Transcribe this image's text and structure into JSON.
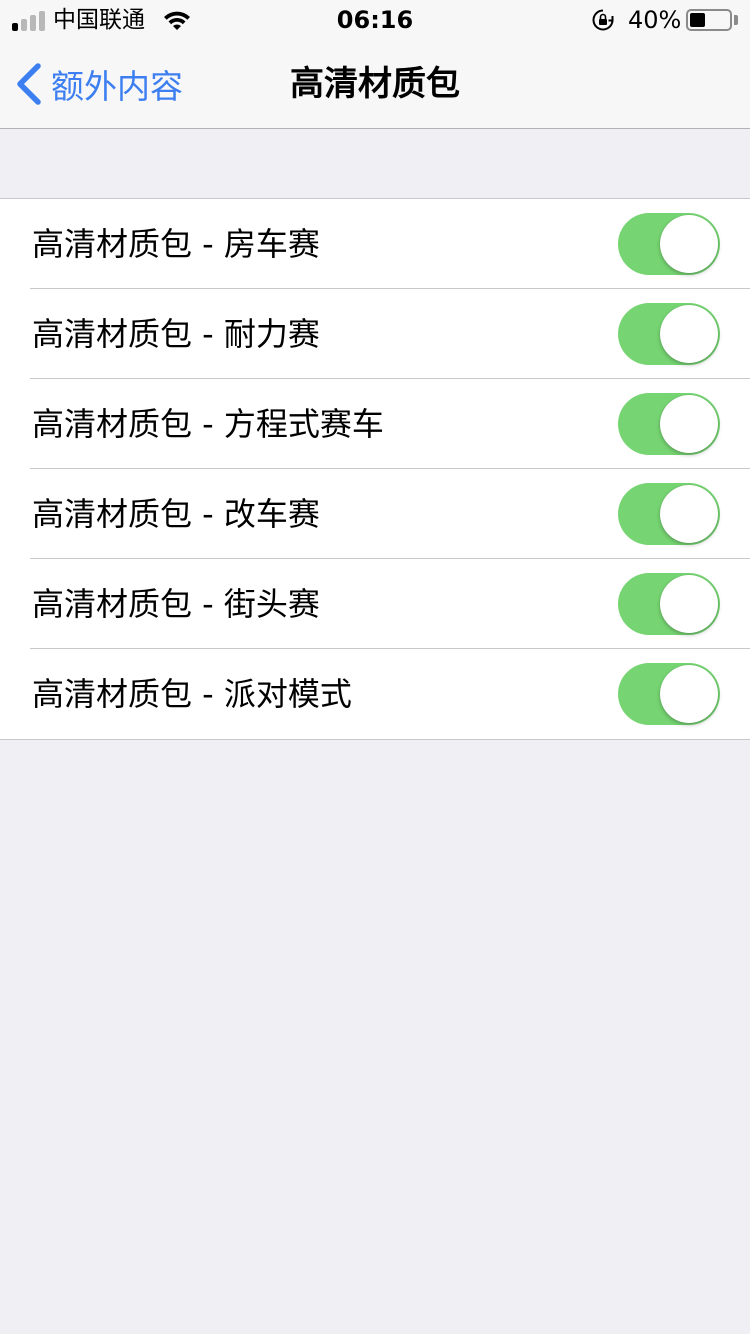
{
  "status_bar": {
    "carrier": "中国联通",
    "time": "06:16",
    "battery_percent": "40%",
    "battery_level": 0.4,
    "signal_bars_filled": 1,
    "signal_bars_total": 4
  },
  "nav": {
    "back_label": "额外内容",
    "title": "高清材质包"
  },
  "items": [
    {
      "label": "高清材质包 - 房车赛",
      "enabled": true
    },
    {
      "label": "高清材质包 - 耐力赛",
      "enabled": true
    },
    {
      "label": "高清材质包 - 方程式赛车",
      "enabled": true
    },
    {
      "label": "高清材质包 - 改车赛",
      "enabled": true
    },
    {
      "label": "高清材质包 - 街头赛",
      "enabled": true
    },
    {
      "label": "高清材质包 - 派对模式",
      "enabled": true
    }
  ],
  "colors": {
    "accent": "#3d7ff1",
    "toggle_on": "#76d572",
    "background": "#efeff4"
  },
  "icons": {
    "back": "chevron-left-icon",
    "wifi": "wifi-icon",
    "orientation_lock": "orientation-lock-icon",
    "battery": "battery-icon",
    "signal": "signal-strength-icon"
  }
}
